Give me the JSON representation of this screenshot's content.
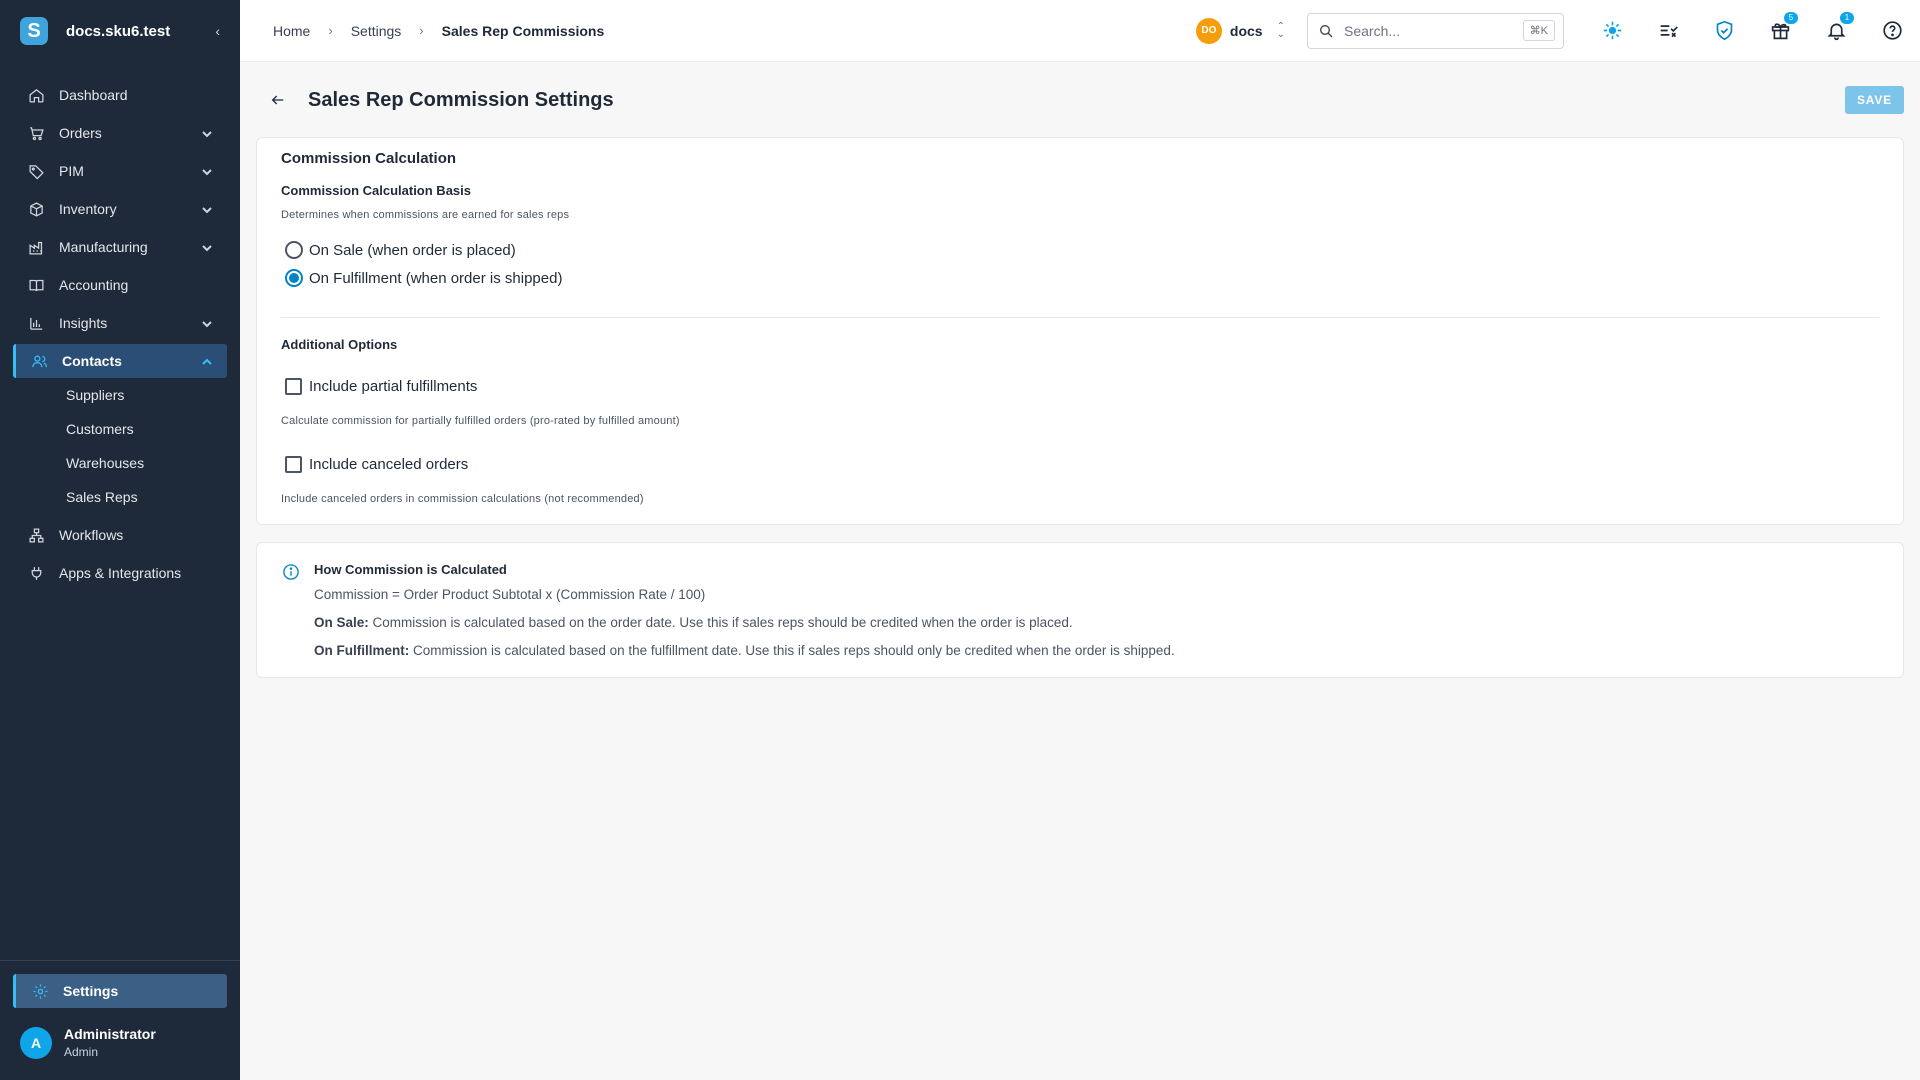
{
  "app": {
    "brand_logo_letter": "S",
    "brand_name": "docs.sku6.test"
  },
  "sidebar": {
    "items": [
      {
        "label": "Dashboard"
      },
      {
        "label": "Orders"
      },
      {
        "label": "PIM"
      },
      {
        "label": "Inventory"
      },
      {
        "label": "Manufacturing"
      },
      {
        "label": "Accounting"
      },
      {
        "label": "Insights"
      },
      {
        "label": "Contacts"
      },
      {
        "label": "Workflows"
      },
      {
        "label": "Apps & Integrations"
      }
    ],
    "contacts_sub": [
      {
        "label": "Suppliers"
      },
      {
        "label": "Customers"
      },
      {
        "label": "Warehouses"
      },
      {
        "label": "Sales Reps"
      }
    ],
    "settings_label": "Settings",
    "user": {
      "initial": "A",
      "name": "Administrator",
      "role": "Admin"
    }
  },
  "header": {
    "breadcrumb": [
      "Home",
      "Settings",
      "Sales Rep Commissions"
    ],
    "workspace_initials": "DO",
    "workspace_name": "docs",
    "search_placeholder": "Search...",
    "search_shortcut": "⌘K",
    "gift_badge": "5",
    "bell_badge": "1"
  },
  "page": {
    "title": "Sales Rep Commission Settings",
    "save_label": "SAVE"
  },
  "calculation": {
    "title": "Commission Calculation",
    "basis_label": "Commission Calculation Basis",
    "basis_help": "Determines when commissions are earned for sales reps",
    "options": [
      {
        "label": "On Sale (when order is placed)",
        "selected": false
      },
      {
        "label": "On Fulfillment (when order is shipped)",
        "selected": true
      }
    ],
    "additional_label": "Additional Options",
    "partial_label": "Include partial fulfillments",
    "partial_help": "Calculate commission for partially fulfilled orders (pro-rated by fulfilled amount)",
    "canceled_label": "Include canceled orders",
    "canceled_help": "Include canceled orders in commission calculations (not recommended)"
  },
  "info": {
    "title": "How Commission is Calculated",
    "formula": "Commission = Order Product Subtotal x (Commission Rate / 100)",
    "on_sale_term": "On Sale:",
    "on_sale_text": " Commission is calculated based on the order date. Use this if sales reps should be credited when the order is placed.",
    "on_fulfillment_term": "On Fulfillment:",
    "on_fulfillment_text": " Commission is calculated based on the fulfillment date. Use this if sales reps should only be credited when the order is shipped."
  },
  "colors": {
    "sidebar_bg": "#1e2939",
    "accent": "#0284c7",
    "save_button": "#7cc4ea",
    "workspace_badge": "#f59e0b"
  }
}
